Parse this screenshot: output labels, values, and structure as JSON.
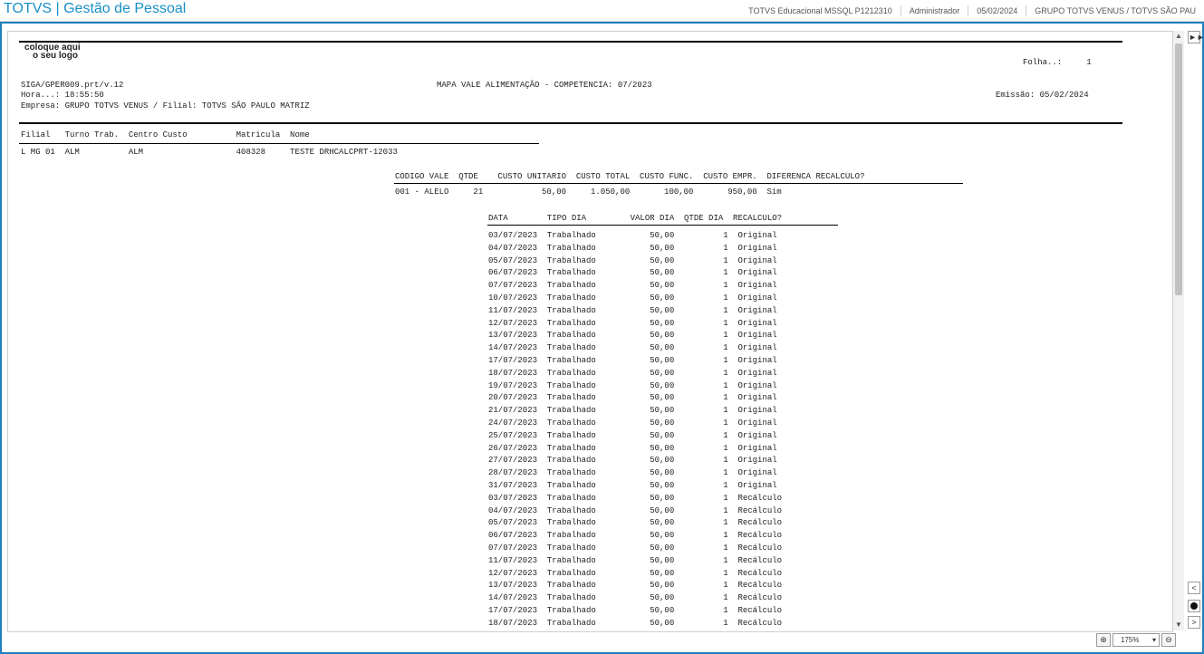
{
  "header": {
    "app_title": "TOTVS | Gestão de Pessoal",
    "environment": "TOTVS Educacional MSSQL P1212310",
    "user": "Administrador",
    "date": "05/02/2024",
    "company": "GRUPO TOTVS VENUS / TOTVS SÃO PAU"
  },
  "report": {
    "logo_line1": "coloque aqui",
    "logo_line2": "o seu logo",
    "folha": "Folha..:     1",
    "program": "SIGA/GPER009.prt/v.12",
    "title": "MAPA VALE ALIMENTAÇÃO - COMPETENCIA: 07/2023",
    "hora": "Hora...: 18:55:50",
    "emissao": "Emissão: 05/02/2024",
    "empresa": "Empresa: GRUPO TOTVS VENUS / Filial: TOTVS SÃO PAULO MATRIZ",
    "employee_header": "Filial   Turno Trab.  Centro Custo          Matricula  Nome",
    "employee_row": "L MG 01  ALM          ALM                   408328     TESTE DRHCALCPRT-12033",
    "vale_header": "CODIGO VALE  QTDE    CUSTO UNITARIO  CUSTO TOTAL  CUSTO FUNC.  CUSTO EMPR.  DIFERENCA RECALCULO?",
    "vale_row": "001 - ALELO     21            50,00     1.050,00       100,00       950,00  Sim",
    "days_header": "DATA        TIPO DIA         VALOR DIA  QTDE DIA  RECALCULO?",
    "days": [
      "03/07/2023  Trabalhado           50,00          1  Original",
      "04/07/2023  Trabalhado           50,00          1  Original",
      "05/07/2023  Trabalhado           50,00          1  Original",
      "06/07/2023  Trabalhado           50,00          1  Original",
      "07/07/2023  Trabalhado           50,00          1  Original",
      "10/07/2023  Trabalhado           50,00          1  Original",
      "11/07/2023  Trabalhado           50,00          1  Original",
      "12/07/2023  Trabalhado           50,00          1  Original",
      "13/07/2023  Trabalhado           50,00          1  Original",
      "14/07/2023  Trabalhado           50,00          1  Original",
      "17/07/2023  Trabalhado           50,00          1  Original",
      "18/07/2023  Trabalhado           50,00          1  Original",
      "19/07/2023  Trabalhado           50,00          1  Original",
      "20/07/2023  Trabalhado           50,00          1  Original",
      "21/07/2023  Trabalhado           50,00          1  Original",
      "24/07/2023  Trabalhado           50,00          1  Original",
      "25/07/2023  Trabalhado           50,00          1  Original",
      "26/07/2023  Trabalhado           50,00          1  Original",
      "27/07/2023  Trabalhado           50,00          1  Original",
      "28/07/2023  Trabalhado           50,00          1  Original",
      "31/07/2023  Trabalhado           50,00          1  Original",
      "03/07/2023  Trabalhado           50,00          1  Recálculo",
      "04/07/2023  Trabalhado           50,00          1  Recálculo",
      "05/07/2023  Trabalhado           50,00          1  Recálculo",
      "06/07/2023  Trabalhado           50,00          1  Recálculo",
      "07/07/2023  Trabalhado           50,00          1  Recálculo",
      "11/07/2023  Trabalhado           50,00          1  Recálculo",
      "12/07/2023  Trabalhado           50,00          1  Recálculo",
      "13/07/2023  Trabalhado           50,00          1  Recálculo",
      "14/07/2023  Trabalhado           50,00          1  Recálculo",
      "17/07/2023  Trabalhado           50,00          1  Recálculo",
      "18/07/2023  Trabalhado           50,00          1  Recálculo"
    ]
  },
  "controls": {
    "zoom": "175%"
  }
}
